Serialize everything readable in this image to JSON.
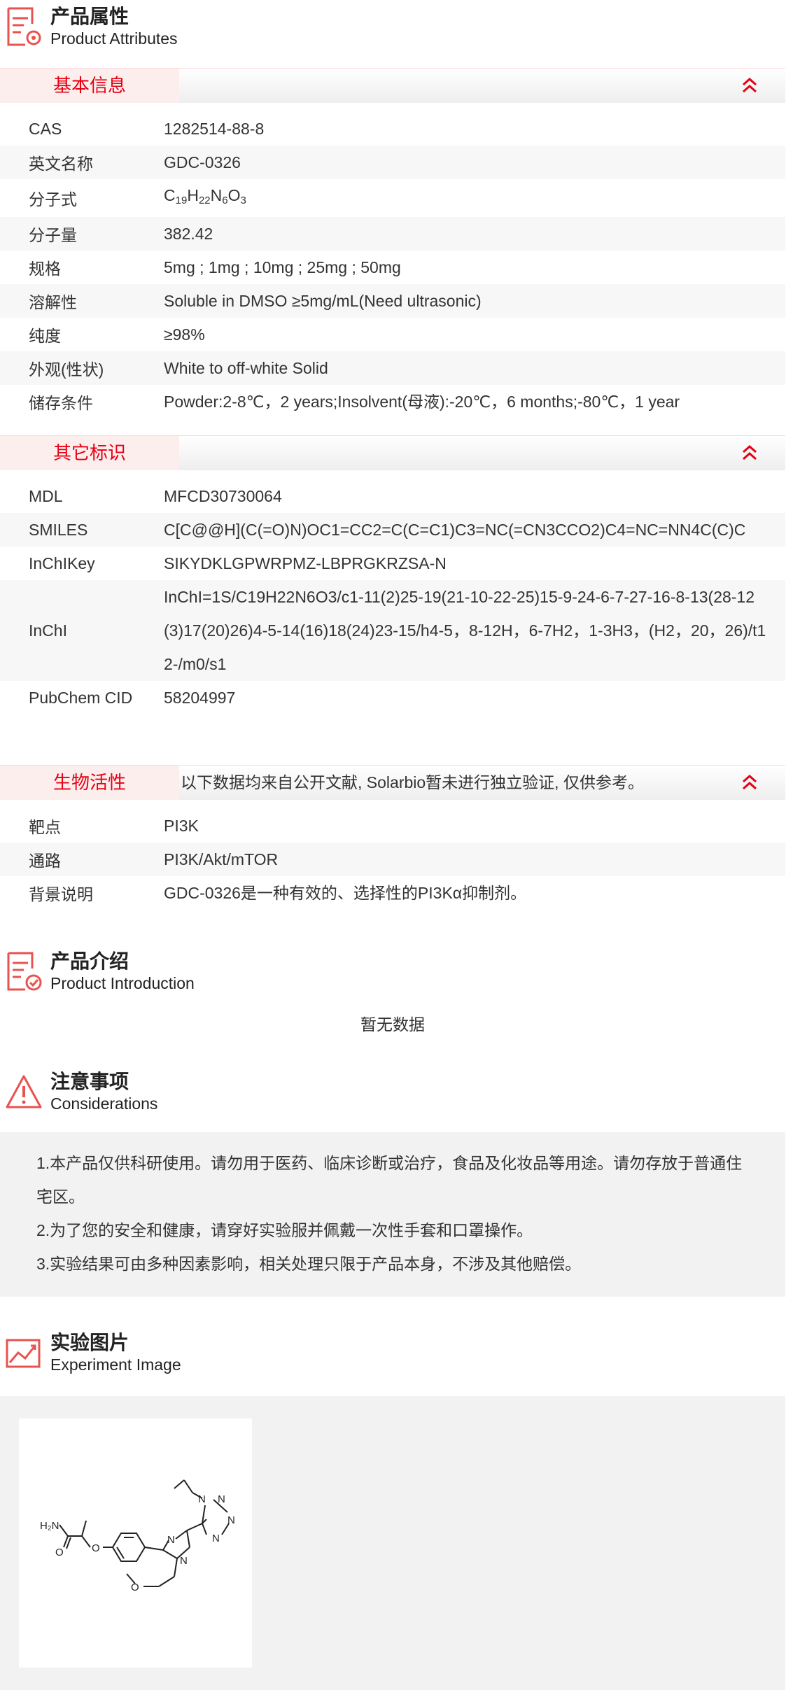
{
  "attributes": {
    "title_cn": "产品属性",
    "title_en": "Product Attributes",
    "basic": {
      "tab": "基本信息",
      "rows": [
        {
          "k": "CAS",
          "v": "1282514-88-8"
        },
        {
          "k": "英文名称",
          "v": "GDC-0326"
        },
        {
          "k": "分子式",
          "v": "C19H22N6O3"
        },
        {
          "k": "分子量",
          "v": "382.42"
        },
        {
          "k": "规格",
          "v": "5mg ; 1mg ; 10mg ; 25mg ; 50mg"
        },
        {
          "k": "溶解性",
          "v": "Soluble in DMSO ≥5mg/mL(Need ultrasonic)"
        },
        {
          "k": "纯度",
          "v": "≥98%"
        },
        {
          "k": "外观(性状)",
          "v": "White to off-white Solid"
        },
        {
          "k": "储存条件",
          "v": "Powder:2-8℃，2 years;Insolvent(母液):-20℃，6 months;-80℃，1 year"
        }
      ]
    },
    "other": {
      "tab": "其它标识",
      "rows": [
        {
          "k": "MDL",
          "v": "MFCD30730064"
        },
        {
          "k": "SMILES",
          "v": "C[C@@H](C(=O)N)OC1=CC2=C(C=C1)C3=NC(=CN3CCO2)C4=NC=NN4C(C)C"
        },
        {
          "k": "InChIKey",
          "v": "SIKYDKLGPWRPMZ-LBPRGKRZSA-N"
        },
        {
          "k": "InChI",
          "v": "InChI=1S/C19H22N6O3/c1-11(2)25-19(21-10-22-25)15-9-24-6-7-27-16-8-13(28-12(3)17(20)26)4-5-14(16)18(24)23-15/h4-5，8-12H，6-7H2，1-3H3，(H2，20，26)/t12-/m0/s1"
        },
        {
          "k": "PubChem CID",
          "v": "58204997"
        }
      ]
    },
    "bio": {
      "tab": "生物活性",
      "note": "以下数据均来自公开文献, Solarbio暂未进行独立验证, 仅供参考。",
      "rows": [
        {
          "k": "靶点",
          "v": "PI3K"
        },
        {
          "k": "通路",
          "v": "PI3K/Akt/mTOR"
        },
        {
          "k": "背景说明",
          "v": "GDC-0326是一种有效的、选择性的PI3Kα抑制剂。"
        }
      ]
    }
  },
  "intro": {
    "title_cn": "产品介绍",
    "title_en": "Product Introduction",
    "empty": "暂无数据"
  },
  "considerations": {
    "title_cn": "注意事项",
    "title_en": "Considerations",
    "items": [
      "1.本产品仅供科研使用。请勿用于医药、临床诊断或治疗，食品及化妆品等用途。请勿存放于普通住宅区。",
      "2.为了您的安全和健康，请穿好实验服并佩戴一次性手套和口罩操作。",
      "3.实验结果可由多种因素影响，相关处理只限于产品本身，不涉及其他赔偿。"
    ]
  },
  "experiment": {
    "title_cn": "实验图片",
    "title_en": "Experiment Image",
    "structure_labels": {
      "nh2": "H₂N",
      "o_carbonyl": "O",
      "o_ether": "O",
      "o_ring": "O",
      "n1": "N",
      "n2": "N",
      "n3": "N",
      "n4": "N",
      "n5": "N",
      "n6": "N"
    }
  },
  "colors": {
    "accent": "#e60012",
    "tab_bg": "#fdeeee",
    "row_alt": "#f7f7f7",
    "panel": "#f2f2f2"
  },
  "icons": [
    "document-gear-icon",
    "chevron-double-up-icon",
    "document-check-icon",
    "warning-triangle-icon",
    "image-chart-icon"
  ]
}
